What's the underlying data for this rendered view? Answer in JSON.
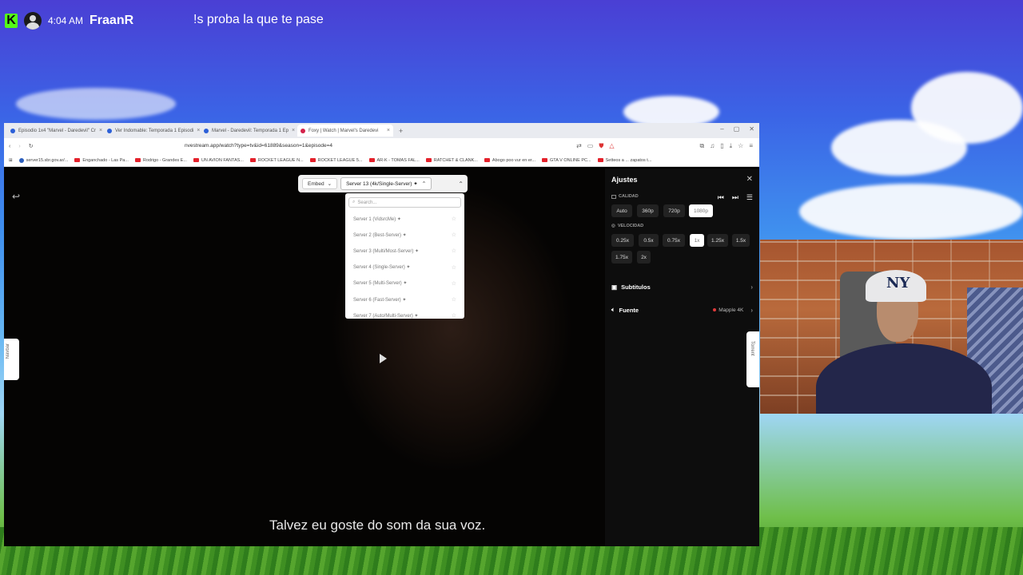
{
  "stream": {
    "platform_logo": "K",
    "time": "4:04 AM",
    "username": "FraanR",
    "chat_message": "!s proba la que te pase"
  },
  "browser": {
    "tabs": [
      {
        "title": "Episodio 1x4 \"Marvel - Daredevil\" Cr",
        "icon": "globe"
      },
      {
        "title": "Ver Indomable: Temporada 1 Episodi",
        "icon": "globe"
      },
      {
        "title": "Marvel - Daredevil: Temporada 1 Ep",
        "icon": "globe"
      },
      {
        "title": "Foxy | Watch | Marvel's Daredevi",
        "icon": "red",
        "active": true
      }
    ],
    "url": "nvestream.app/watch?type=tv&id=61889&season=1&episode=4",
    "bookmarks": [
      {
        "label": "server15.sbr.gov.ar/...",
        "icon": "globe"
      },
      {
        "label": "Enganchado - Las Pa...",
        "icon": "yt"
      },
      {
        "label": "Rodrigo - Grandes E...",
        "icon": "yt"
      },
      {
        "label": "UN AVION FANTAS...",
        "icon": "yt"
      },
      {
        "label": "ROCKET LEAGUE N...",
        "icon": "yt"
      },
      {
        "label": "ROCKET LEAGUE 5...",
        "icon": "yt"
      },
      {
        "label": "AR-K - TOMAS FAL...",
        "icon": "yt"
      },
      {
        "label": "RATCHET & CLANK...",
        "icon": "yt"
      },
      {
        "label": "Abogo poo vur en er...",
        "icon": "yt"
      },
      {
        "label": "GTA V ONLINE PC...",
        "icon": "yt"
      },
      {
        "label": "Setteos a ... zapatos t...",
        "icon": "yt"
      }
    ]
  },
  "player": {
    "embed_label": "Embed",
    "server_selected": "Server 13 (4k/Single-Server) ✦",
    "search_placeholder": "Search...",
    "servers": [
      "Server 1 (VidsrcMe) ✦",
      "Server 2 (Best-Server) ✦",
      "Server 3 (Multi/Most-Server) ✦",
      "Server 4 (Single-Server) ✦",
      "Server 5 (Multi-Server) ✦",
      "Server 6 (Fast-Server) ✦",
      "Server 7 (Auto/Multi-Server) ✦"
    ],
    "subtitle_text": "Talvez eu goste do som da sua voz.",
    "left_tab_label": "Navbar",
    "right_tab_label": "Torrent"
  },
  "settings": {
    "title": "Ajustes",
    "quality_label": "CALIDAD",
    "quality_options": [
      "Auto",
      "360p",
      "720p",
      "1080p"
    ],
    "quality_selected": "1080p",
    "speed_label": "VELOCIDAD",
    "speed_options": [
      "0.25x",
      "0.5x",
      "0.75x",
      "1x",
      "1.25x",
      "1.5x",
      "1.75x",
      "2x"
    ],
    "speed_selected": "1x",
    "subtitles_label": "Subtitulos",
    "source_label": "Fuente",
    "source_value": "Mapple 4K"
  }
}
